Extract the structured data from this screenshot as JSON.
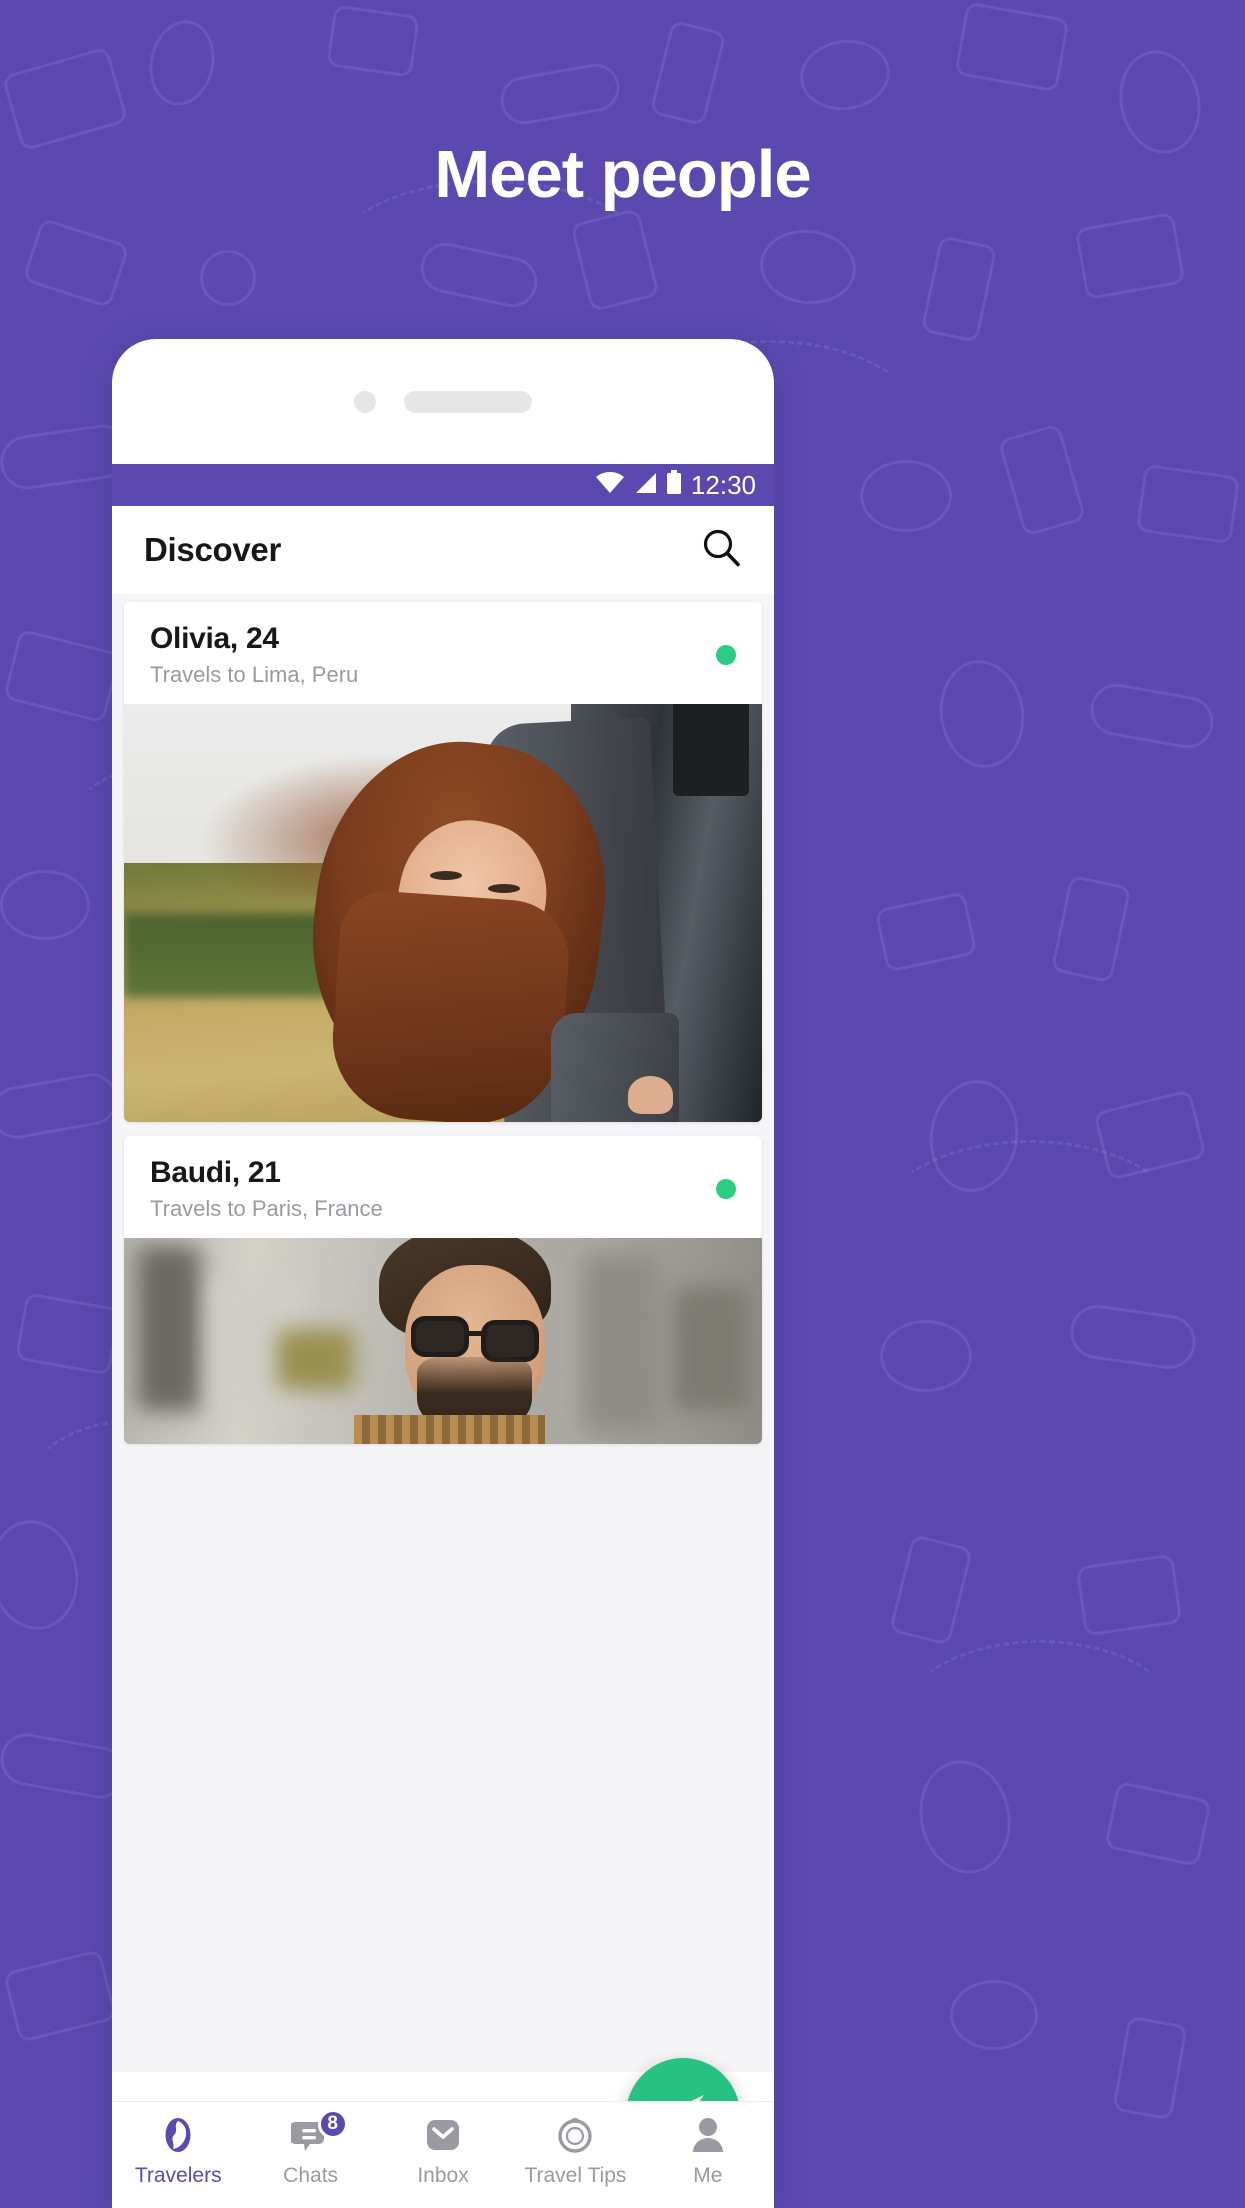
{
  "headline": "Meet people",
  "theme": {
    "brand_purple": "#5b49b0",
    "accent_green": "#27c281",
    "status_online": "#2ecc83",
    "text_primary": "#18181b",
    "text_muted": "#9a9aa2",
    "surface": "#ffffff",
    "list_background": "#f5f5f7"
  },
  "phone": {
    "statusbar": {
      "time": "12:30",
      "icons": [
        "wifi-icon",
        "cellular-signal-icon",
        "battery-icon"
      ]
    },
    "header": {
      "title": "Discover",
      "search_icon": "search-icon"
    },
    "cards": [
      {
        "name": "Olivia, 24",
        "subtitle": "Travels to Lima, Peru",
        "online": true,
        "photo": "woman-leaning-out-of-car-window"
      },
      {
        "name": "Baudi, 21",
        "subtitle": "Travels to Paris, France",
        "online": true,
        "photo": "man-with-glasses-on-city-street"
      }
    ],
    "fab": {
      "icon": "send-paper-plane-icon",
      "label": "Send"
    },
    "bottom_nav": [
      {
        "label": "Travelers",
        "icon": "globe-icon",
        "active": true,
        "badge": null
      },
      {
        "label": "Chats",
        "icon": "chat-icon",
        "active": false,
        "badge": "8"
      },
      {
        "label": "Inbox",
        "icon": "envelope-icon",
        "active": false,
        "badge": null
      },
      {
        "label": "Travel Tips",
        "icon": "compass-icon",
        "active": false,
        "badge": null
      },
      {
        "label": "Me",
        "icon": "person-icon",
        "active": false,
        "badge": null
      }
    ]
  }
}
